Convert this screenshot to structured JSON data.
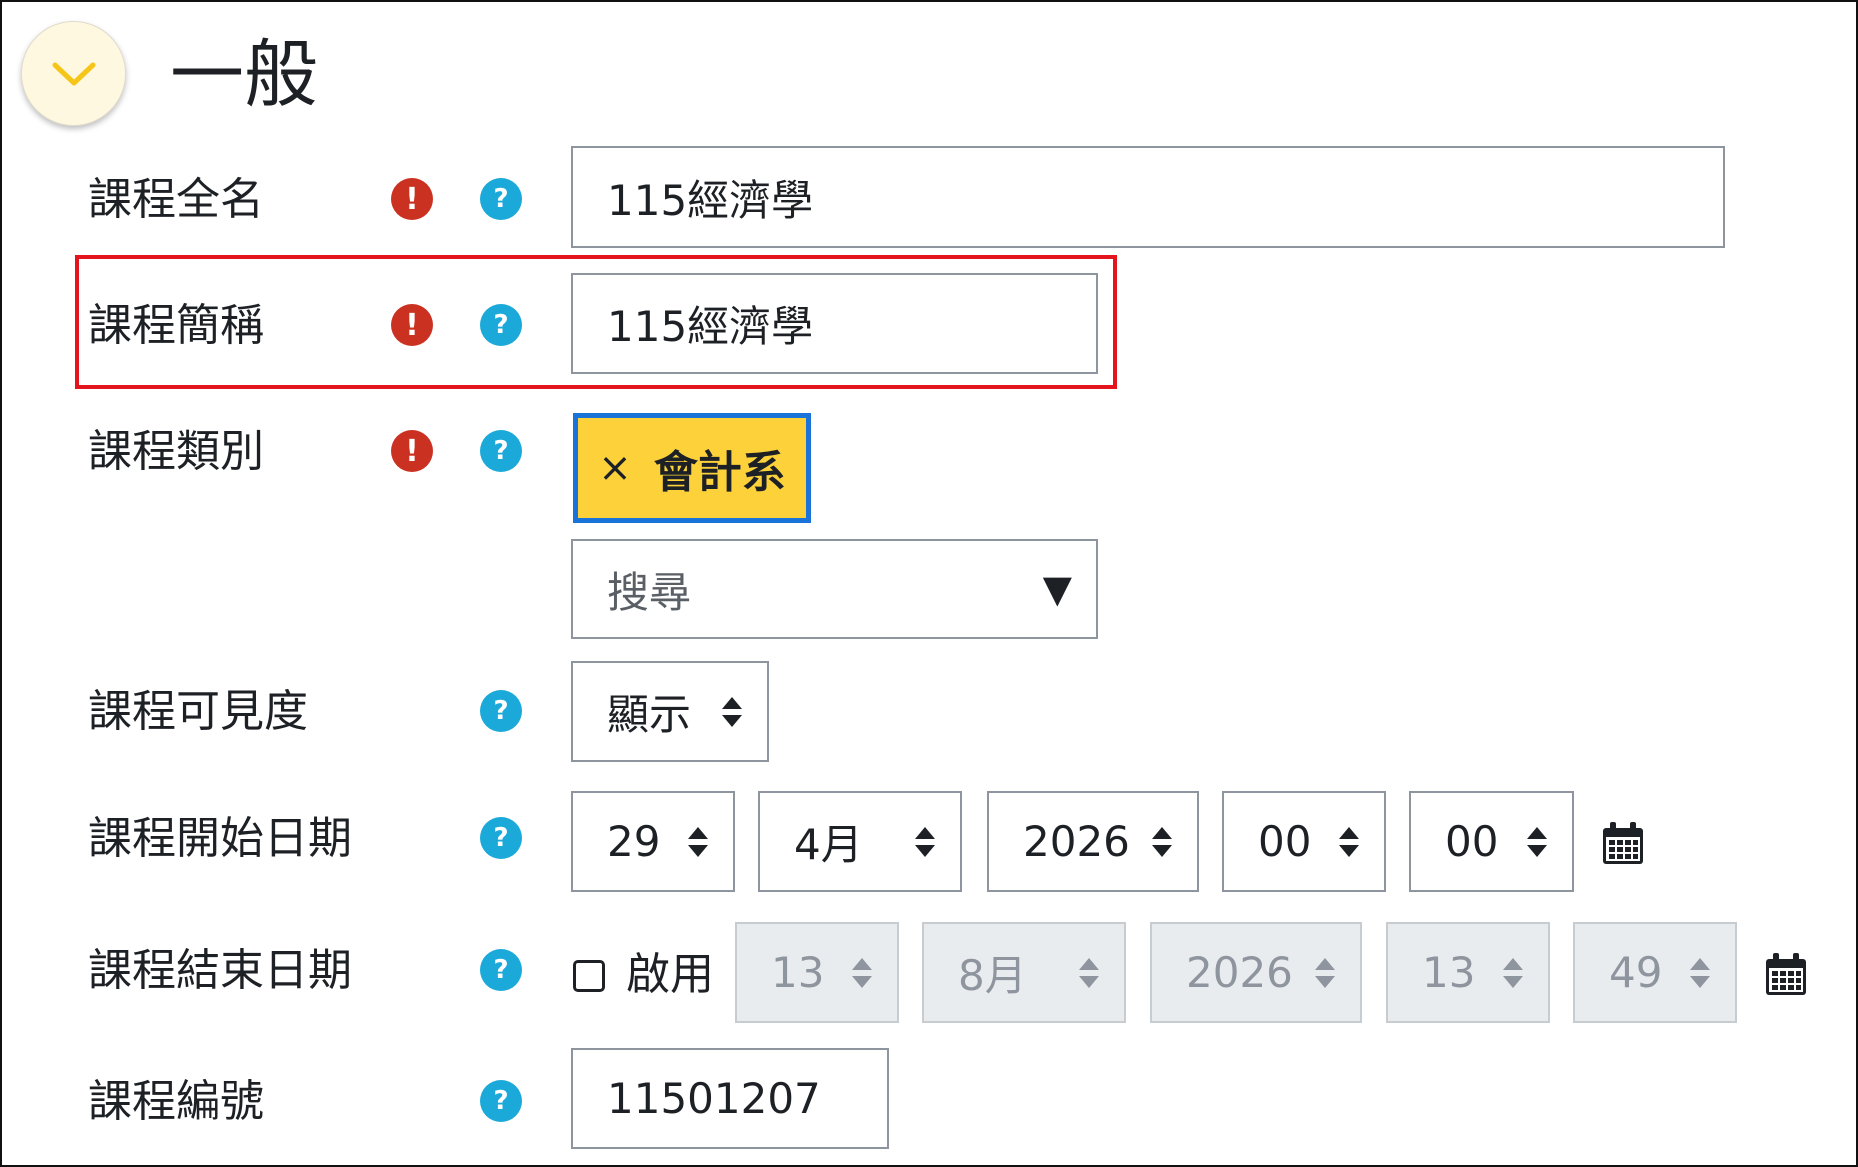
{
  "section": {
    "title": "一般"
  },
  "fields": {
    "fullname": {
      "label": "課程全名",
      "value": "115經濟學"
    },
    "shortname": {
      "label": "課程簡稱",
      "value": "115經濟學"
    },
    "category": {
      "label": "課程類別",
      "tag": "會計系",
      "remove_glyph": "×",
      "search_placeholder": "搜尋",
      "dropdown_glyph": "▼"
    },
    "visibility": {
      "label": "課程可見度",
      "value": "顯示"
    },
    "startdate": {
      "label": "課程開始日期",
      "day": "29",
      "month": "4月",
      "year": "2026",
      "hour": "00",
      "minute": "00"
    },
    "enddate": {
      "label": "課程結束日期",
      "enable_label": "啟用",
      "day": "13",
      "month": "8月",
      "year": "2026",
      "hour": "13",
      "minute": "49"
    },
    "idnumber": {
      "label": "課程編號",
      "value": "11501207"
    }
  },
  "icons": {
    "required": "!",
    "help": "?",
    "required_color": "#ca3120",
    "help_color": "#1ba9d9",
    "tag_color": "#fcd13a",
    "highlight_color": "#e3141e"
  }
}
